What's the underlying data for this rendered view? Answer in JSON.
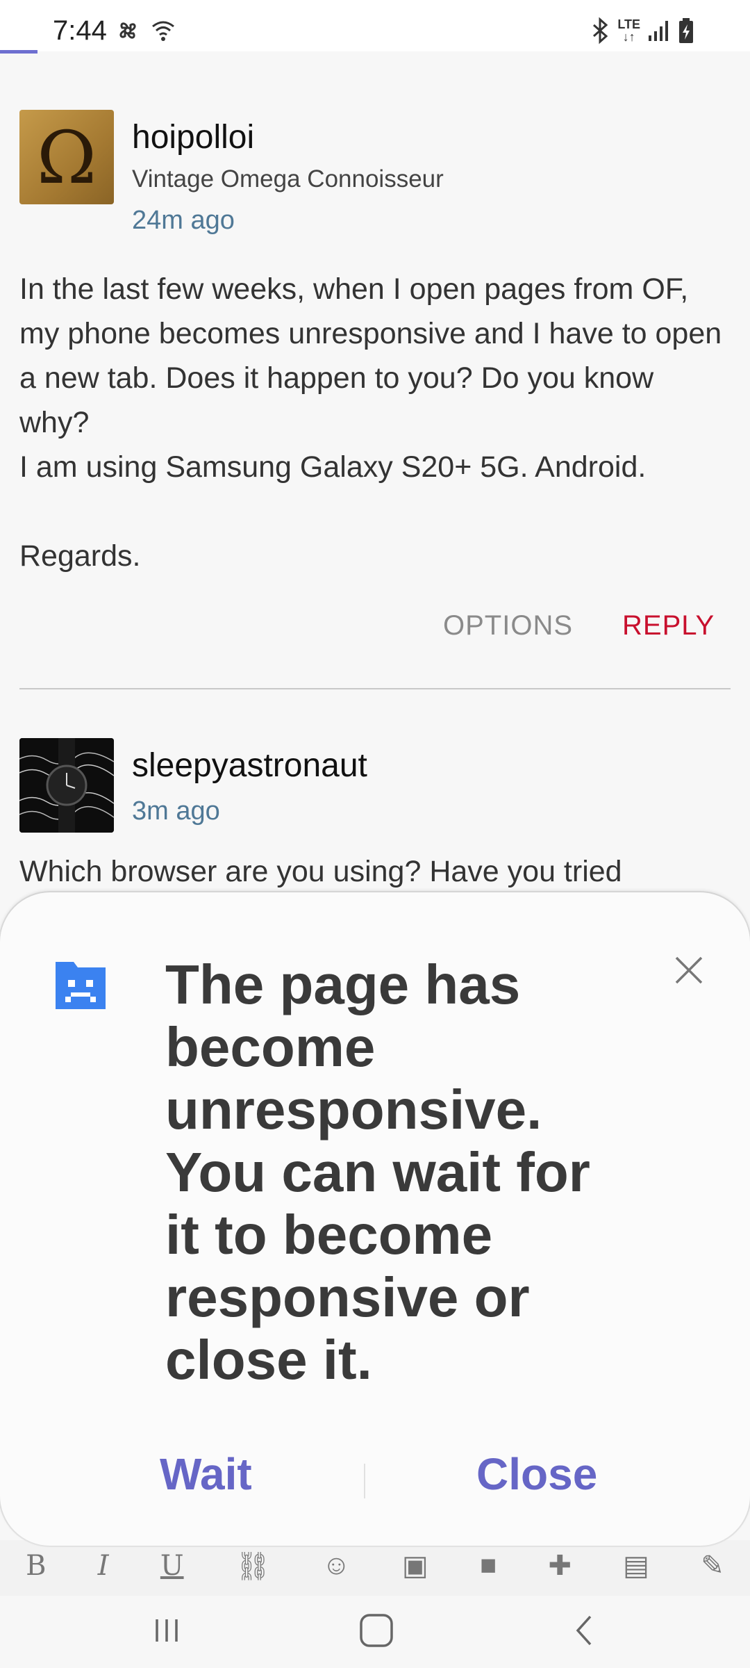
{
  "status_bar": {
    "time": "7:44",
    "left_icons": [
      "fan-icon",
      "wifi-icon"
    ],
    "right_icons": [
      "bluetooth-icon",
      "lte-icon",
      "signal-icon",
      "battery-icon"
    ],
    "network_label": "LTE"
  },
  "posts": [
    {
      "username": "hoipolloi",
      "user_title": "Vintage Omega Connoisseur",
      "time_ago": "24m ago",
      "body": "In the last few weeks, when I open pages from OF, my phone becomes unresponsive and I have to open a new tab. Does it happen to you? Do you know why?\nI am using Samsung Galaxy S20+ 5G. Android.\n\nRegards.",
      "options_label": "OPTIONS",
      "reply_label": "REPLY",
      "avatar_symbol": "Ω"
    },
    {
      "username": "sleepyastronaut",
      "time_ago": "3m ago",
      "body": "Which browser are you using? Have you tried"
    }
  ],
  "dialog": {
    "message": "The page has become unresponsive. You can wait for it to become responsive or close it.",
    "wait_label": "Wait",
    "close_label": "Close",
    "icon": "sad-page-icon",
    "accent_color": "#6666c6"
  },
  "toolbar": {
    "items": [
      "B",
      "I",
      "U",
      "link-icon",
      "emoji-icon",
      "image-icon",
      "video-icon",
      "plus-icon",
      "save-icon",
      "more-icon"
    ]
  },
  "nav": {
    "items": [
      "recent-apps-icon",
      "home-icon",
      "back-icon"
    ]
  }
}
